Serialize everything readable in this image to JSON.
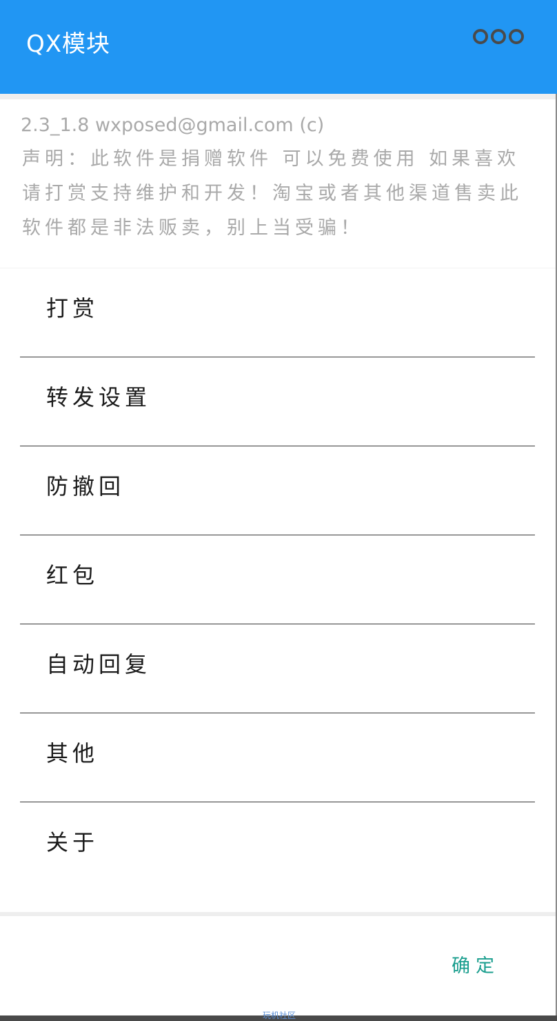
{
  "app": {
    "title": "QX模块",
    "menu_icon": "more-options-icon",
    "accent_color": "#2196F3"
  },
  "info": {
    "version_line": "2.3_1.8 wxposed@gmail.com (c)",
    "notice": "声明：此软件是捐赠软件 可以免费使用 如果喜欢请打赏支持维护和开发！淘宝或者其他渠道售卖此软件都是非法贩卖，别上当受骗！"
  },
  "menu": {
    "items": [
      {
        "label": "打赏"
      },
      {
        "label": "转发设置"
      },
      {
        "label": "防撤回"
      },
      {
        "label": "红包"
      },
      {
        "label": "自动回复"
      },
      {
        "label": "其他"
      },
      {
        "label": "关于"
      }
    ]
  },
  "footer": {
    "confirm_label": "确定",
    "confirm_color": "#1a9e8e",
    "watermark": "玩机社区"
  }
}
